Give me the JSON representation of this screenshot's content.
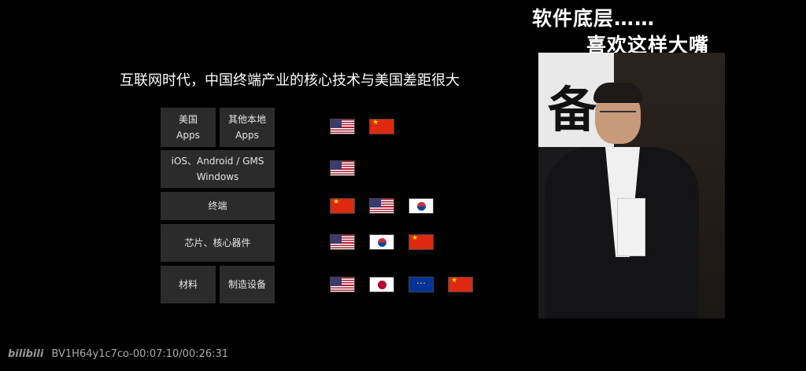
{
  "subtitles": {
    "line1": "软件底层……",
    "line2": "喜欢这样大嘴"
  },
  "slide": {
    "title": "互联网时代，中国终端产业的核心技术与美国差距很大",
    "rows": [
      {
        "labels": [
          "美国\nApps",
          "其他本地\nApps"
        ],
        "flags": [
          "us",
          "cn"
        ]
      },
      {
        "labels": [
          "iOS、Android / GMS\nWindows"
        ],
        "flags": [
          "us"
        ]
      },
      {
        "labels": [
          "终端"
        ],
        "flags": [
          "cn",
          "us",
          "kr"
        ]
      },
      {
        "labels": [
          "芯片、核心器件"
        ],
        "flags": [
          "us",
          "kr",
          "cn"
        ]
      },
      {
        "labels": [
          "材料",
          "制造设备"
        ],
        "flags": [
          "us",
          "jp",
          "eu",
          "cn"
        ]
      }
    ]
  },
  "video": {
    "background_character": "备"
  },
  "watermark": {
    "logo": "bilibili",
    "text": "BV1H64y1c7co-00:07:10/00:26:31"
  }
}
